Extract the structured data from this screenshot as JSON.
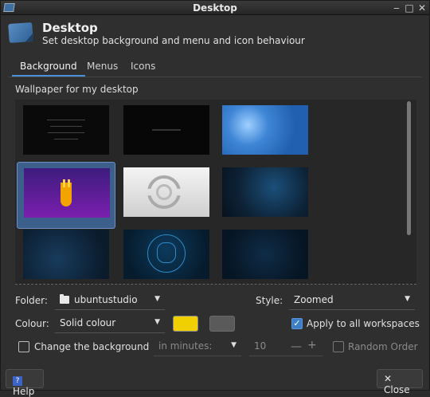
{
  "window": {
    "title": "Desktop",
    "controls": {
      "minimize": "‒",
      "maximize": "□",
      "close": "✕"
    }
  },
  "header": {
    "title": "Desktop",
    "subtitle": "Set desktop background and menu and icon behaviour",
    "icon": "desktop-settings-icon"
  },
  "tabs": [
    {
      "label": "Background",
      "active": true
    },
    {
      "label": "Menus",
      "active": false
    },
    {
      "label": "Icons",
      "active": false
    }
  ],
  "background": {
    "section_label": "Wallpaper for my desktop",
    "wallpapers": [
      {
        "name": "wallpaper-dark-text",
        "selected": false
      },
      {
        "name": "wallpaper-dark-minimal",
        "selected": false
      },
      {
        "name": "wallpaper-blue-bokeh",
        "selected": false
      },
      {
        "name": "wallpaper-purple-ubuntustudio",
        "selected": true
      },
      {
        "name": "wallpaper-light-circles",
        "selected": false
      },
      {
        "name": "wallpaper-dark-blue-1",
        "selected": false
      },
      {
        "name": "wallpaper-dark-blue-2",
        "selected": false
      },
      {
        "name": "wallpaper-dark-blue-mascot",
        "selected": false
      },
      {
        "name": "wallpaper-dark-blue-3",
        "selected": false
      }
    ],
    "folder_label": "Folder:",
    "folder_value": "ubuntustudio",
    "style_label": "Style:",
    "style_value": "Zoomed",
    "colour_label": "Colour:",
    "colour_value": "Solid colour",
    "primary_colour": "#f0d000",
    "secondary_colour": "#5a5a5a",
    "apply_all_label": "Apply to all workspaces",
    "apply_all_checked": true,
    "change_bg_label": "Change the background",
    "change_bg_checked": false,
    "interval_value": "in minutes:",
    "interval_amount": "10",
    "random_order_label": "Random Order",
    "random_order_checked": false
  },
  "buttons": {
    "help": "Help",
    "close": "Close"
  }
}
